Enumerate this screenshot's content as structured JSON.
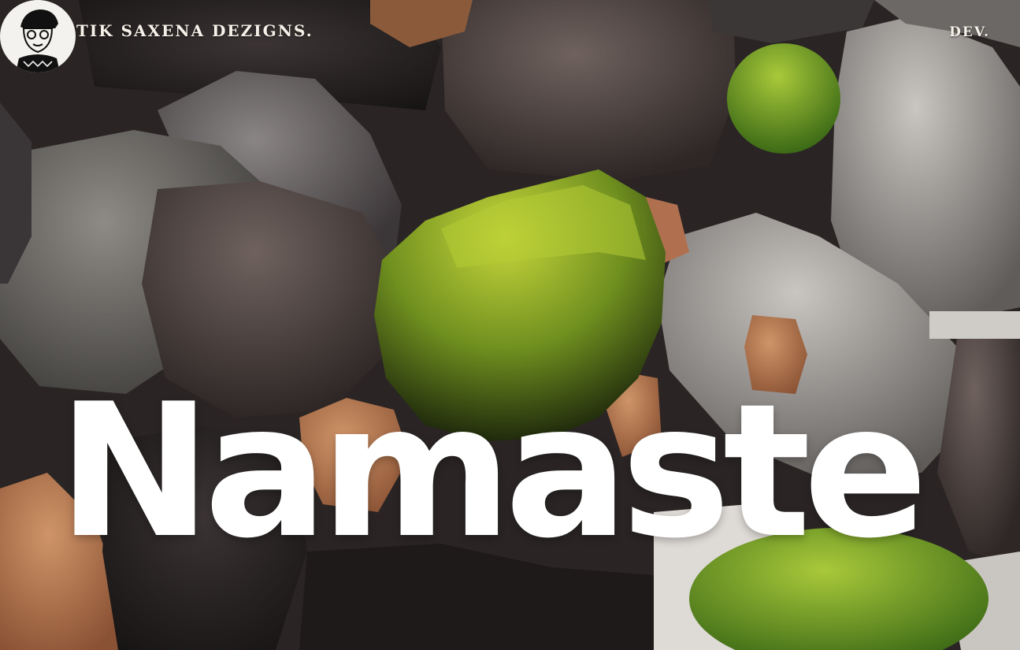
{
  "header": {
    "brand_name": "Tik Saxena Dezigns.",
    "nav_link": "DEV."
  },
  "hero": {
    "title": "Namaste"
  },
  "colors": {
    "text": "#ffffff",
    "moss": "#8fb12a",
    "clay": "#b9784d"
  },
  "icons": {
    "avatar": "cartoon-avatar"
  }
}
